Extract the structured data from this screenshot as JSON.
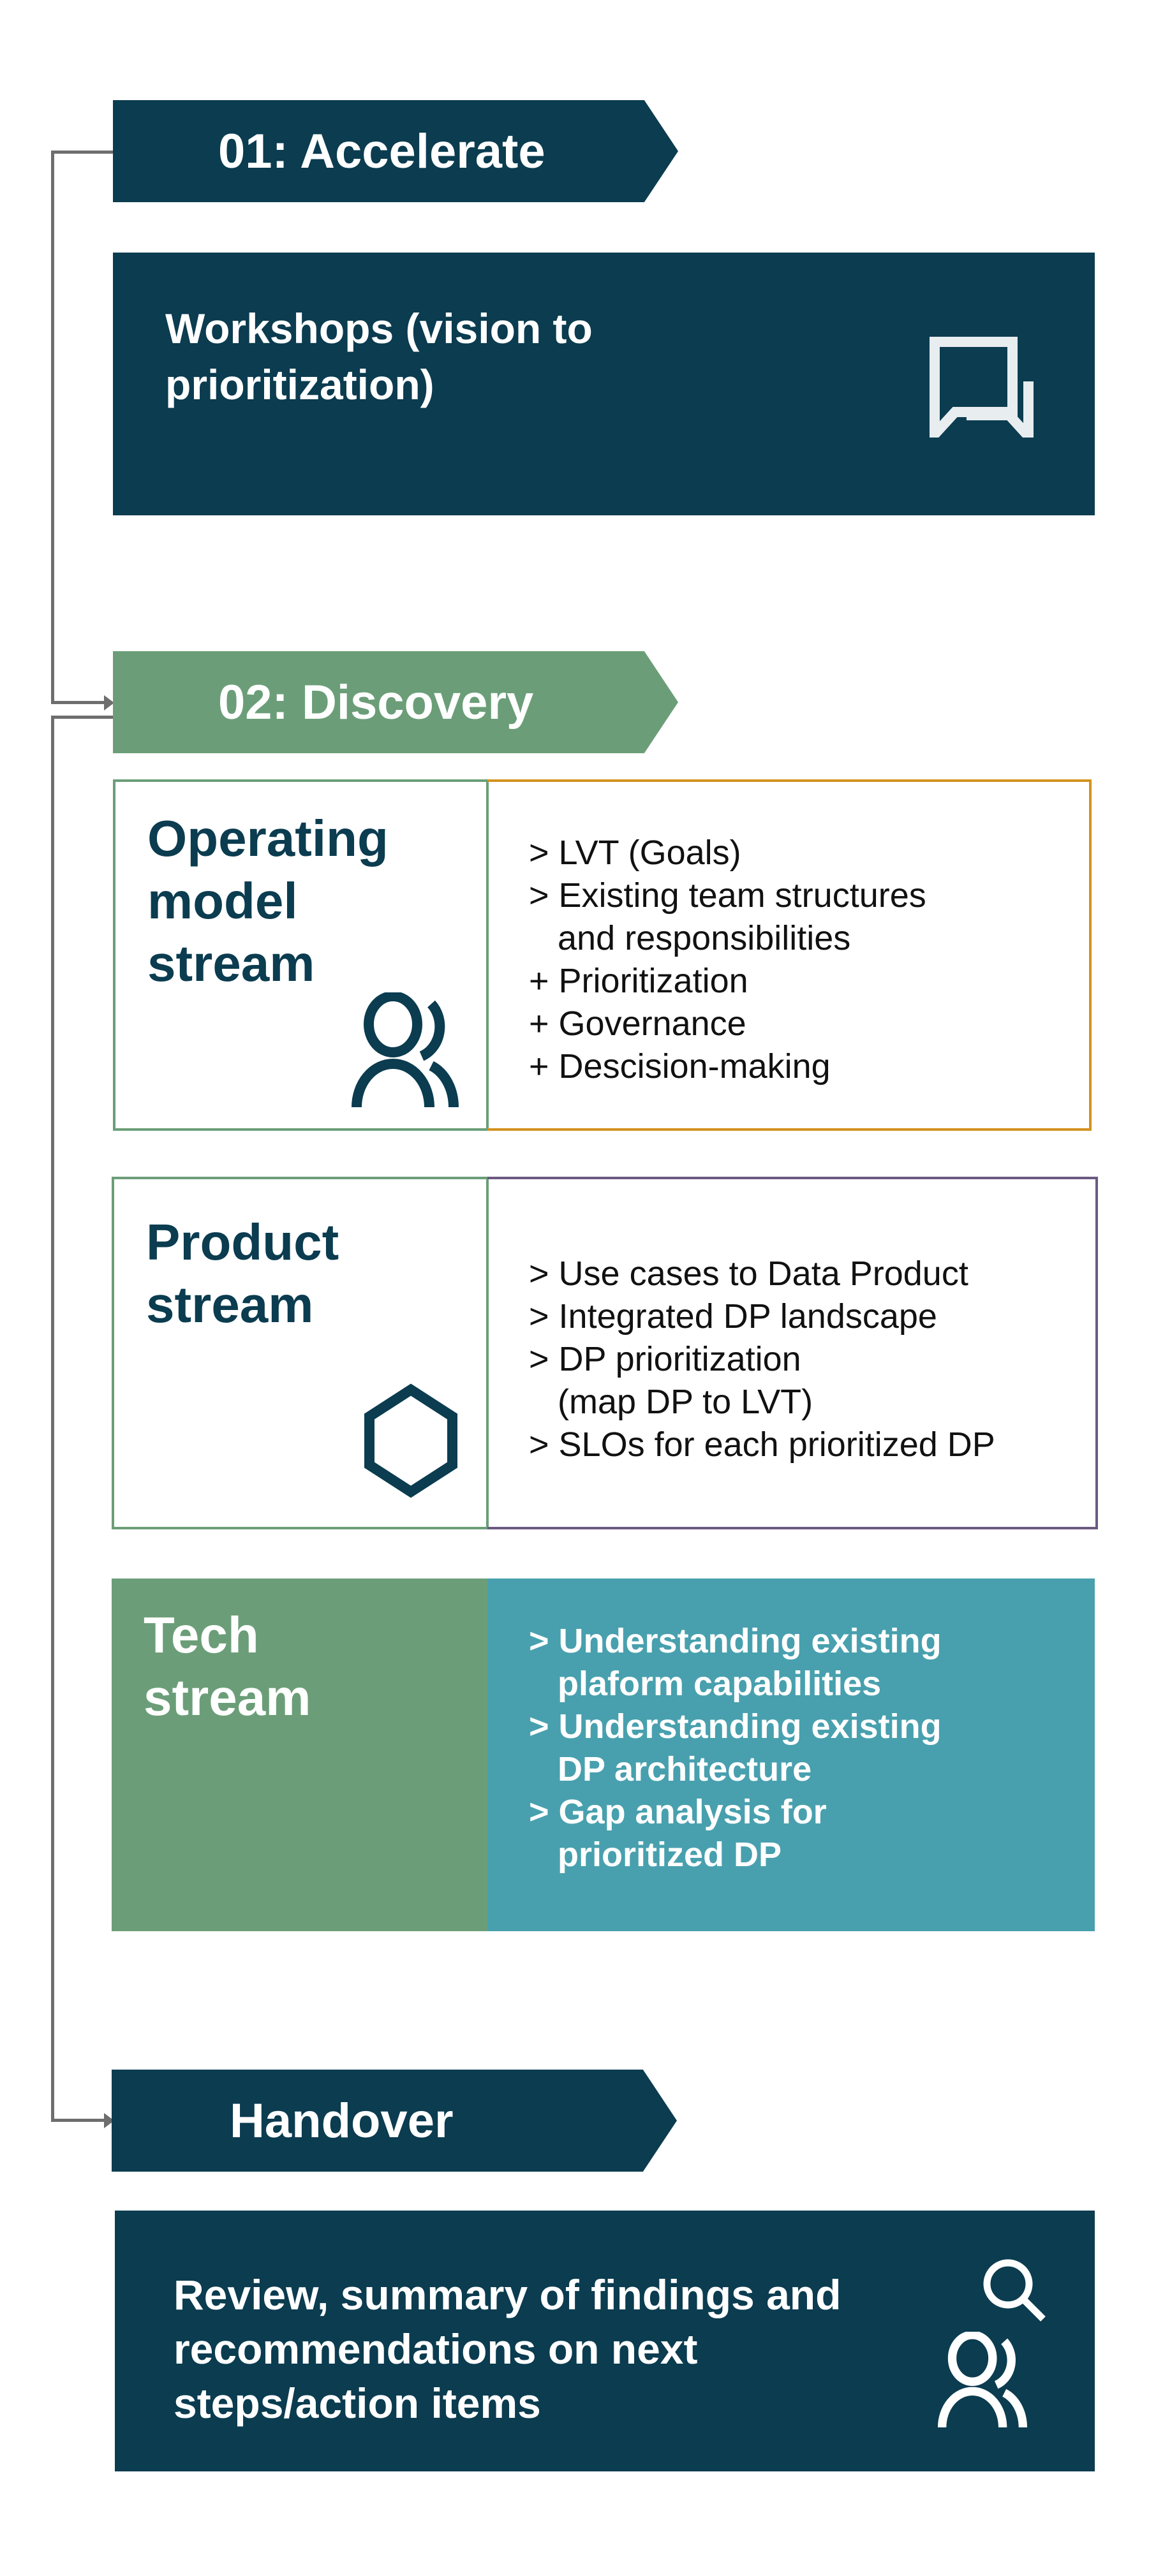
{
  "phases": [
    {
      "label": "01: Accelerate",
      "color": "#0b3c50"
    },
    {
      "label": "02: Discovery",
      "color": "#6b9e78"
    },
    {
      "label": "Handover",
      "color": "#0b3c50"
    }
  ],
  "accelerate_box": {
    "text": "Workshops (vision to prioritization)",
    "icon": "chat-bubbles-icon"
  },
  "streams": [
    {
      "title": "Operating model stream",
      "icon": "users-icon",
      "border_color": "#d4921f",
      "items": [
        "> LVT (Goals)",
        "> Existing team structures",
        "   and responsibilities",
        "+ Prioritization",
        "+ Governance",
        "+ Descision-making"
      ]
    },
    {
      "title": "Product stream",
      "icon": "hexagon-icon",
      "border_color": "#6b5a80",
      "items": [
        "> Use cases to Data Product",
        "> Integrated DP landscape",
        "> DP prioritization",
        "   (map DP to LVT)",
        "> SLOs for each prioritized DP"
      ]
    },
    {
      "title": "Tech stream",
      "color": "#6b9e78",
      "detail_color": "#48a0ae",
      "items": [
        "> Understanding existing",
        "   plaform capabilities",
        "> Understanding existing",
        "   DP architecture",
        "> Gap analysis for",
        "   prioritized DP"
      ]
    }
  ],
  "handover_box": {
    "text": "Review, summary of findings and recommendations on next steps/action items",
    "icons": [
      "search-icon",
      "users-icon"
    ]
  }
}
